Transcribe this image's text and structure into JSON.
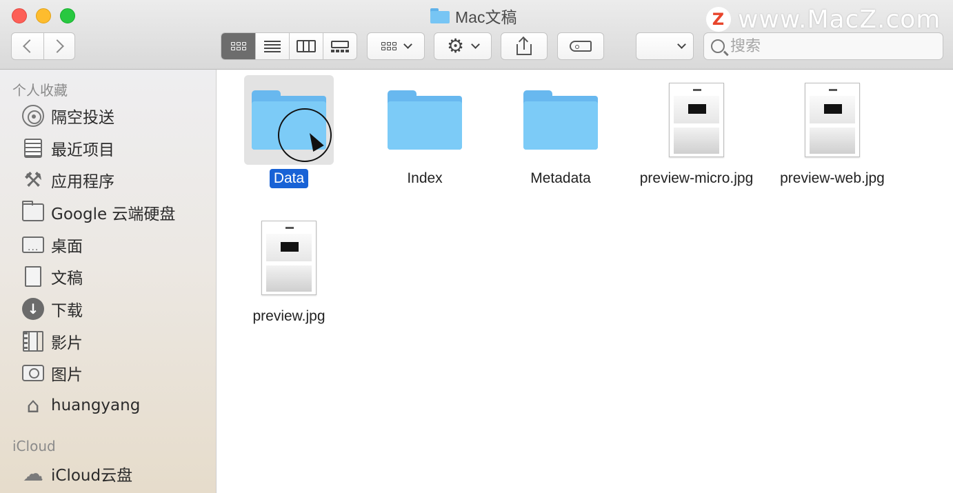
{
  "window": {
    "title": "Mac文稿"
  },
  "watermark": {
    "logo_letter": "Z",
    "text": "www.MacZ.com"
  },
  "toolbar": {
    "back_icon": "chevron-left-icon",
    "forward_icon": "chevron-right-icon",
    "view_modes": [
      "icon",
      "list",
      "columns",
      "gallery"
    ],
    "active_view": "icon",
    "arrange_icon": "grid-icon",
    "action_icon": "gear-icon",
    "share_icon": "share-icon",
    "tag_icon": "tag-icon"
  },
  "search": {
    "placeholder": "搜索"
  },
  "sidebar": {
    "favorites_title": "个人收藏",
    "favorites": [
      {
        "label": "隔空投送",
        "icon": "airdrop-icon"
      },
      {
        "label": "最近项目",
        "icon": "recents-icon"
      },
      {
        "label": "应用程序",
        "icon": "applications-icon"
      },
      {
        "label": "Google 云端硬盘",
        "icon": "folder-icon"
      },
      {
        "label": "桌面",
        "icon": "desktop-icon"
      },
      {
        "label": "文稿",
        "icon": "documents-icon"
      },
      {
        "label": "下载",
        "icon": "downloads-icon"
      },
      {
        "label": "影片",
        "icon": "movies-icon"
      },
      {
        "label": "图片",
        "icon": "pictures-icon"
      },
      {
        "label": "huangyang",
        "icon": "home-icon"
      }
    ],
    "icloud_title": "iCloud",
    "icloud": [
      {
        "label": "iCloud云盘",
        "icon": "cloud-icon"
      }
    ]
  },
  "files": [
    {
      "name": "Data",
      "type": "folder",
      "selected": true
    },
    {
      "name": "Index",
      "type": "folder",
      "selected": false
    },
    {
      "name": "Metadata",
      "type": "folder",
      "selected": false
    },
    {
      "name": "preview-micro.jpg",
      "type": "image",
      "selected": false
    },
    {
      "name": "preview-web.jpg",
      "type": "image",
      "selected": false
    },
    {
      "name": "preview.jpg",
      "type": "image",
      "selected": false
    }
  ],
  "colors": {
    "selection": "#1862d6",
    "folder": "#7ccbf7"
  }
}
